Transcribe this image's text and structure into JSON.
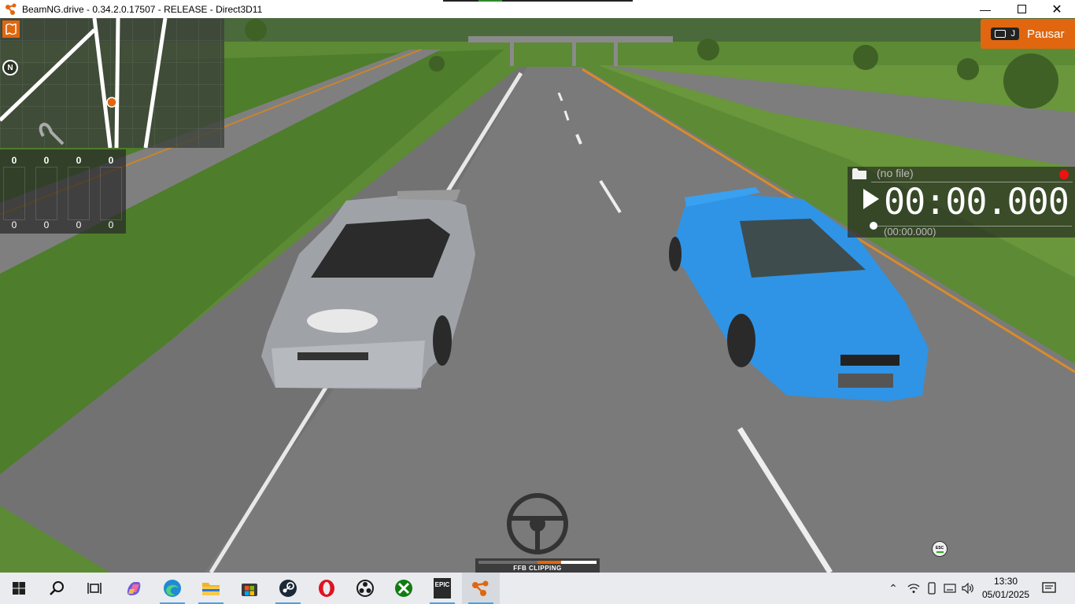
{
  "window": {
    "title": "BeamNG.drive - 0.34.2.0.17507 - RELEASE - Direct3D11",
    "controls": [
      "minimize-icon",
      "maximize-icon",
      "close-icon"
    ]
  },
  "hud": {
    "pause": {
      "key": "J",
      "label": "Pausar"
    },
    "input_columns": [
      {
        "top": "0",
        "bottom": "0"
      },
      {
        "top": "0",
        "bottom": "0"
      },
      {
        "top": "0",
        "bottom": "0"
      },
      {
        "top": "0",
        "bottom": "0"
      }
    ],
    "replay": {
      "file": "(no file)",
      "time": "00:00.000",
      "sub_time": "(00:00.000)"
    },
    "ffb": {
      "label": "FFB CLIPPING"
    },
    "esc_label": "ESC"
  },
  "taskbar": {
    "apps": [
      "windows-start-icon",
      "search-icon",
      "task-view-icon",
      "copilot-icon",
      "edge-icon",
      "file-explorer-icon",
      "microsoft-store-icon",
      "steam-icon",
      "opera-icon",
      "obs-icon",
      "xbox-icon",
      "epic-games-icon",
      "beamng-icon"
    ],
    "epic_text": "EPIC",
    "clock": {
      "time": "13:30",
      "date": "05/01/2025"
    }
  },
  "colors": {
    "accent": "#e0670f",
    "record": "#f21010",
    "taskbar": "#e9ebee"
  }
}
